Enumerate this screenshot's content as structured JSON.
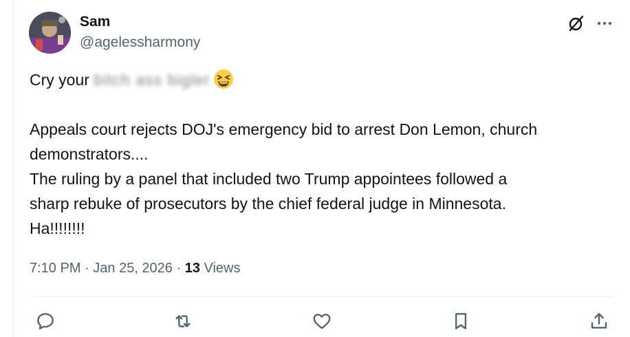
{
  "author": {
    "name": "Sam",
    "handle": "@agelessharmony"
  },
  "post": {
    "line1_prefix": "Cry your ",
    "line1_blurred": "bitch ass bigler",
    "line1_emoji": "grinning-squinting-face-emoji",
    "line2": "Appeals court rejects DOJ's emergency bid to arrest Don Lemon, church",
    "line3": "demonstrators....",
    "line4": "The ruling by a panel that included two Trump appointees followed a",
    "line5": "sharp rebuke of prosecutors by the chief federal judge in Minnesota.",
    "line6": "Ha!!!!!!!!"
  },
  "meta": {
    "time": "7:10 PM",
    "separator1": " · ",
    "date": "Jan 25, 2026",
    "separator2": " · ",
    "views_count": "13",
    "views_label": " Views"
  },
  "icons": {
    "header": [
      "grok-icon",
      "more-icon"
    ],
    "actions": [
      "reply-icon",
      "repost-icon",
      "like-icon",
      "bookmark-icon",
      "share-icon"
    ]
  },
  "colors": {
    "text": "#0f1419",
    "secondary": "#536471",
    "border": "#eff3f4"
  }
}
